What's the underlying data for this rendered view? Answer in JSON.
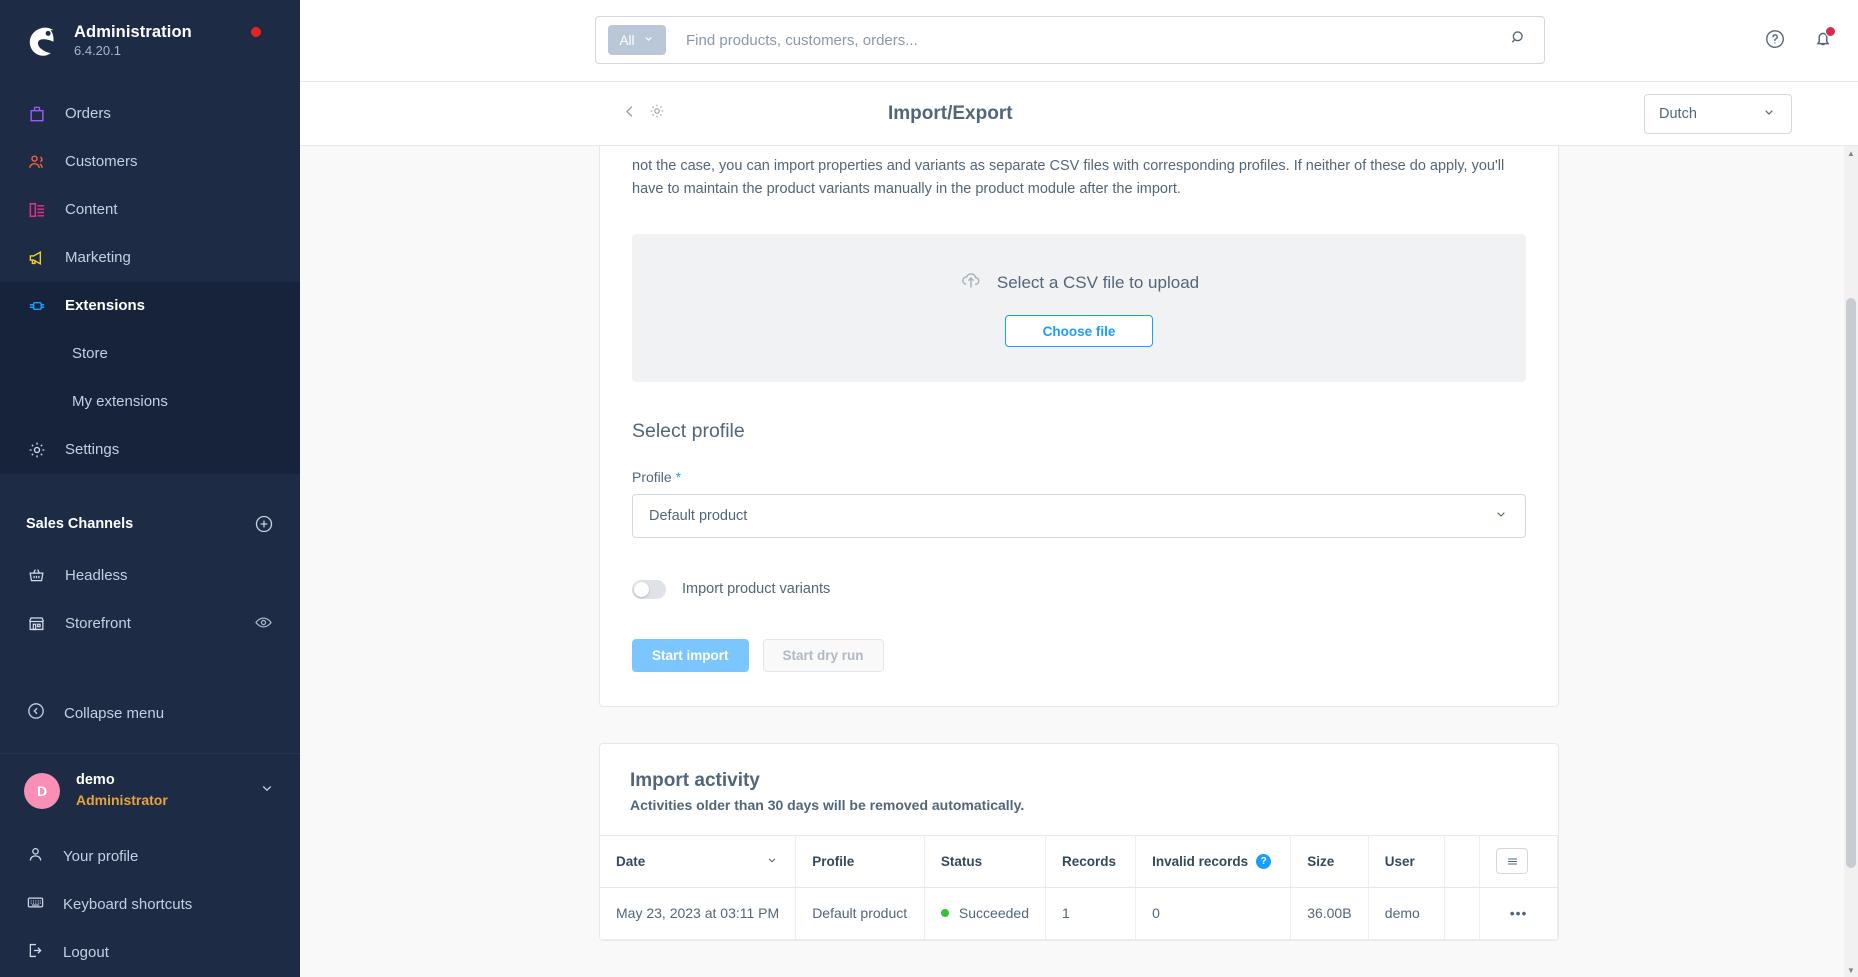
{
  "sidebar": {
    "brand": {
      "title": "Administration",
      "version": "6.4.20.1",
      "logo_icon": "shopware-logo-icon",
      "status_dot_color": "#e52427"
    },
    "nav": [
      {
        "label": "Orders",
        "icon": "bag-icon",
        "color": "#a259f7",
        "active": false
      },
      {
        "label": "Customers",
        "icon": "users-icon",
        "color": "#f4623a",
        "active": false
      },
      {
        "label": "Content",
        "icon": "content-icon",
        "color": "#e8308a",
        "active": false
      },
      {
        "label": "Marketing",
        "icon": "megaphone-icon",
        "color": "#f5d020",
        "active": false
      },
      {
        "label": "Extensions",
        "icon": "plug-icon",
        "color": "#189eff",
        "active": true
      }
    ],
    "sub_nav": [
      {
        "label": "Store"
      },
      {
        "label": "My extensions"
      }
    ],
    "settings": {
      "label": "Settings",
      "icon": "gear-icon"
    },
    "sales_channels": {
      "title": "Sales Channels",
      "add_icon": "plus-circle-icon",
      "items": [
        {
          "label": "Headless",
          "icon": "basket-icon",
          "trailing_icon": ""
        },
        {
          "label": "Storefront",
          "icon": "shop-icon",
          "trailing_icon": "eye-icon"
        }
      ]
    },
    "collapse": {
      "label": "Collapse menu",
      "icon": "chevron-left-circle-icon"
    },
    "user": {
      "initial": "D",
      "name": "demo",
      "role": "Administrator",
      "chevron_icon": "chevron-down-icon"
    },
    "footer_items": [
      {
        "label": "Your profile",
        "icon": "person-icon"
      },
      {
        "label": "Keyboard shortcuts",
        "icon": "keyboard-icon"
      },
      {
        "label": "Logout",
        "icon": "logout-icon"
      }
    ]
  },
  "topbar": {
    "search": {
      "scope_label": "All",
      "placeholder": "Find products, customers, orders...",
      "value": "",
      "scope_chevron_icon": "chevron-down-icon",
      "search_icon": "search-icon"
    },
    "help_icon": "help-circle-icon",
    "notifications_icon": "bell-icon",
    "notifications_badge_color": "#de294c"
  },
  "pagehead": {
    "back_icon": "chevron-left-icon",
    "settings_icon": "gear-icon",
    "title": "Import/Export",
    "language": {
      "value": "Dutch",
      "chevron_icon": "chevron-down-icon"
    }
  },
  "import_card": {
    "intro_text": "not the case, you can import properties and variants as separate CSV files with corresponding profiles. If neither of these do apply, you'll have to maintain the product variants manually in the product module after the import.",
    "dropzone": {
      "icon": "cloud-upload-icon",
      "label": "Select a CSV file to upload",
      "button_label": "Choose file"
    },
    "section_title": "Select profile",
    "profile_label": "Profile",
    "profile_required_mark": "*",
    "profile_value": "Default product",
    "profile_chevron_icon": "chevron-down-icon",
    "variants_toggle_label": "Import product variants",
    "variants_toggle_on": false,
    "start_import_label": "Start import",
    "start_dry_run_label": "Start dry run"
  },
  "activity": {
    "title": "Import activity",
    "subtitle": "Activities older than 30 days will be removed automatically.",
    "columns": [
      {
        "label": "Date",
        "sort_icon": "chevron-down-icon"
      },
      {
        "label": "Profile"
      },
      {
        "label": "Status"
      },
      {
        "label": "Records"
      },
      {
        "label": "Invalid records",
        "help_icon": "question-badge-icon"
      },
      {
        "label": "Size"
      },
      {
        "label": "User"
      }
    ],
    "grid_menu_icon": "list-menu-icon",
    "rows": [
      {
        "date": "May 23, 2023 at 03:11 PM",
        "profile": "Default product",
        "status": "Succeeded",
        "status_color": "#37c137",
        "records": "1",
        "invalid_records": "0",
        "size": "36.00B",
        "user": "demo",
        "actions_icon": "ellipsis-icon"
      }
    ]
  }
}
